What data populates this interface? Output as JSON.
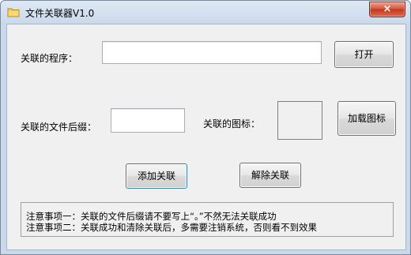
{
  "window": {
    "title": "文件关联器V1.0",
    "close_label": "×"
  },
  "form": {
    "program_label": "关联的程序：",
    "program_value": "",
    "open_button": "打开",
    "suffix_label": "关联的文件后缀：",
    "suffix_value": "",
    "icon_label": "关联的图标：",
    "load_icon_button": "加载图标",
    "add_button": "添加关联",
    "remove_button": "解除关联"
  },
  "notes": [
    "注意事项一：关联的文件后缀请不要写上“。”不然无法关联成功",
    "注意事项二：关联成功和清除关联后，多需要注销系统，否则看不到效果"
  ],
  "colors": {
    "close_button": "#c4381f",
    "titlebar": "#c9d8ea",
    "client_background": "#f0f0f0"
  }
}
